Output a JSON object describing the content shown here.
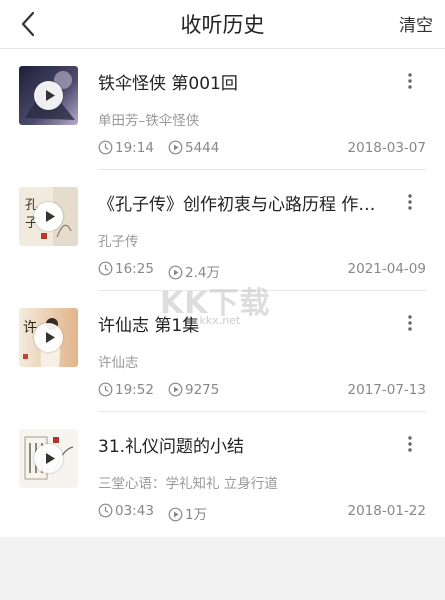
{
  "header": {
    "title": "收听历史",
    "clear_label": "清空"
  },
  "items": [
    {
      "title": "铁伞怪侠 第001回",
      "subtitle": "单田芳–铁伞怪侠",
      "duration": "19:14",
      "plays": "5444",
      "date": "2018-03-07",
      "cover_colors": [
        "#2b2f4a",
        "#7f7a97",
        "#c8c2d6"
      ]
    },
    {
      "title": "《孔子传》创作初衷与心路历程 作…",
      "subtitle": "孔子传",
      "duration": "16:25",
      "plays": "2.4万",
      "date": "2021-04-09",
      "cover_colors": [
        "#f3ece0",
        "#d9cfbd",
        "#b63a2a"
      ]
    },
    {
      "title": "许仙志 第1集",
      "subtitle": "许仙志",
      "duration": "19:52",
      "plays": "9275",
      "date": "2017-07-13",
      "cover_colors": [
        "#efe6d6",
        "#e7b88f",
        "#c9412f"
      ]
    },
    {
      "title": "31.礼仪问题的小结",
      "subtitle": "三堂心语：学礼知礼 立身行道",
      "duration": "03:43",
      "plays": "1万",
      "date": "2018-01-22",
      "cover_colors": [
        "#f7f3ee",
        "#a89c8f",
        "#b5342a"
      ]
    }
  ],
  "watermark": {
    "main": "KK下载",
    "sub": ".kkx.net"
  },
  "icons": {
    "back": "chevron-left-icon",
    "play": "play-icon",
    "more": "more-vertical-icon",
    "clock": "clock-icon",
    "plays": "play-circle-icon"
  }
}
